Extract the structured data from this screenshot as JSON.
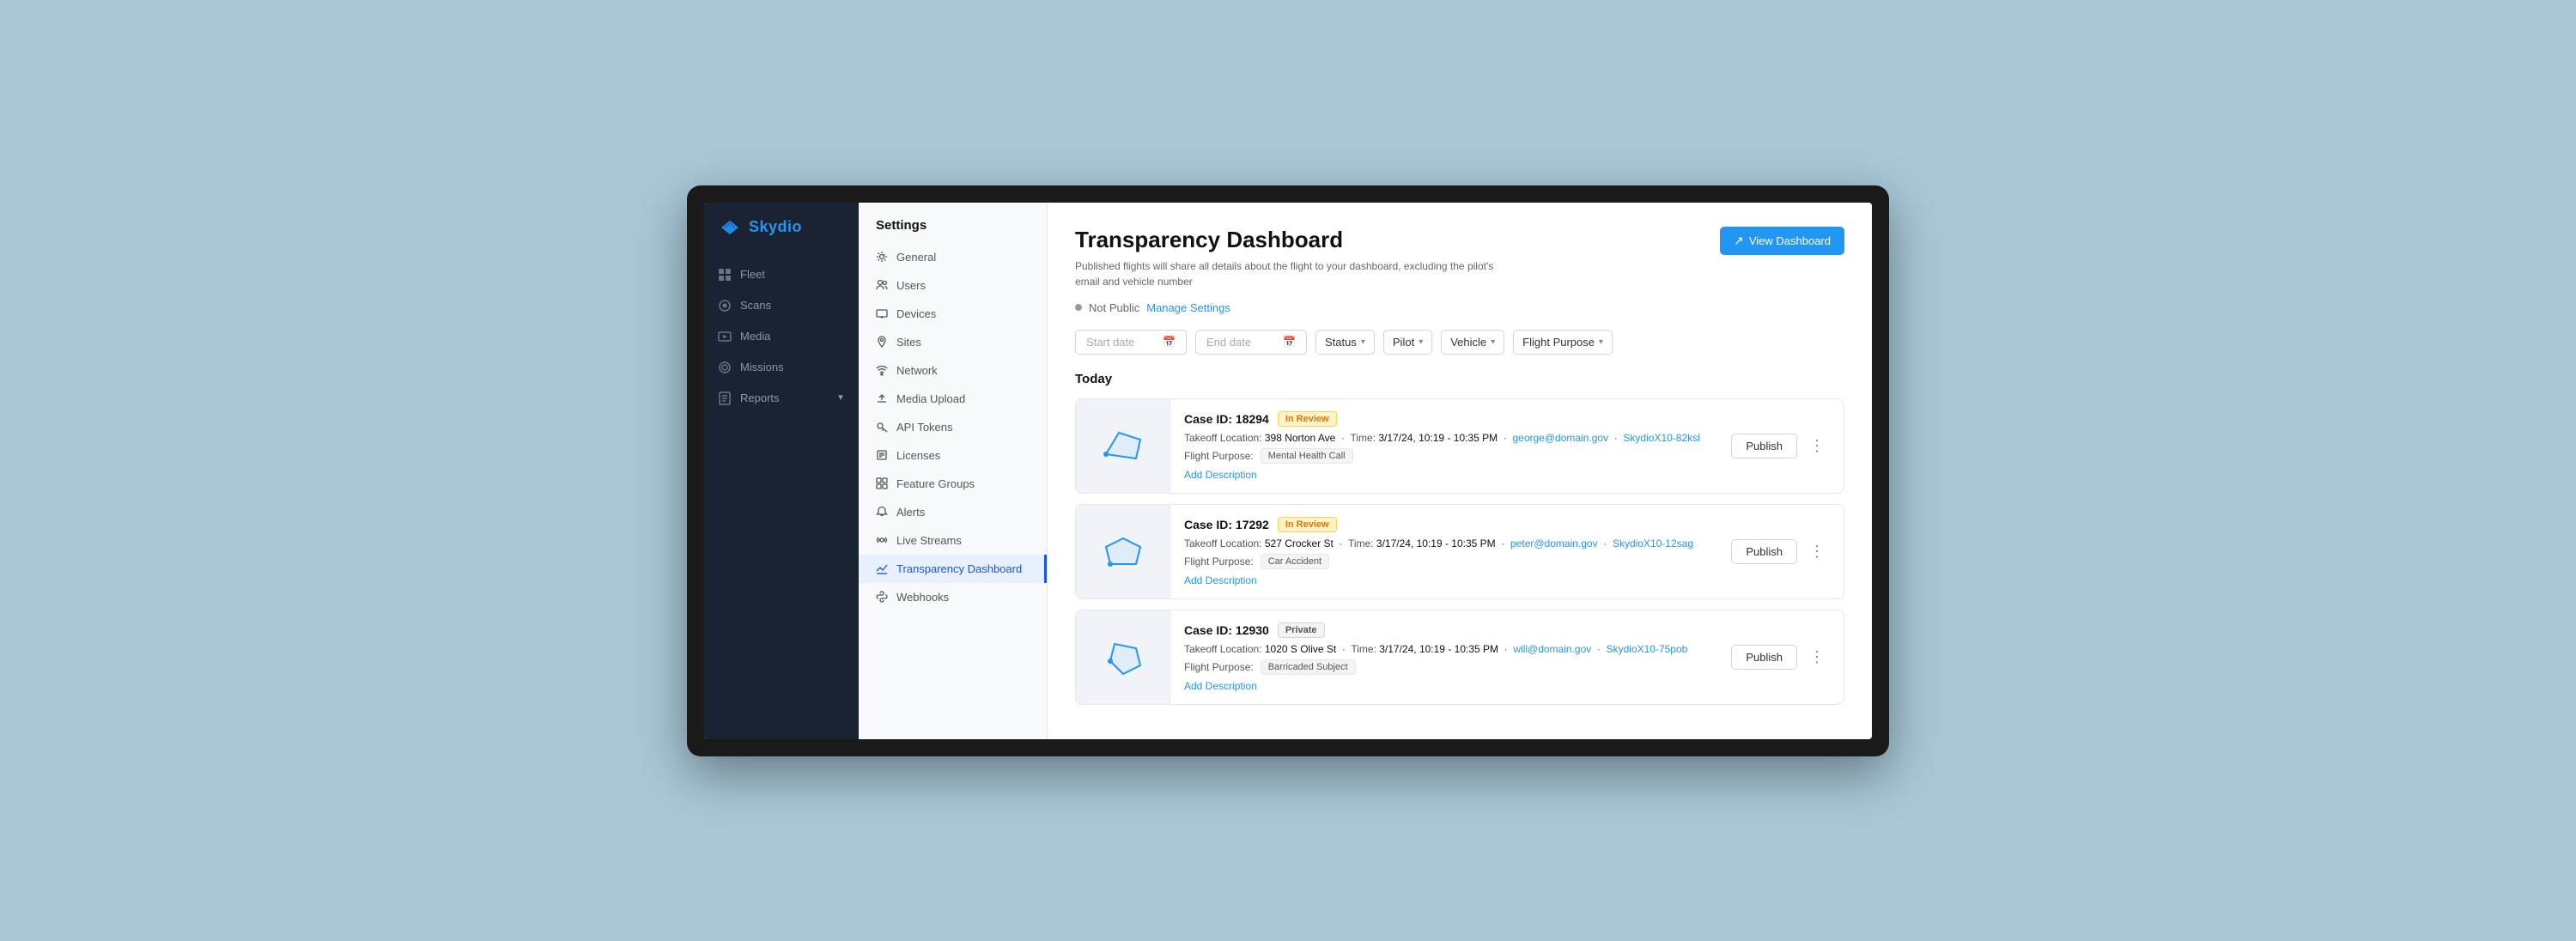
{
  "app": {
    "name": "Skydio"
  },
  "left_nav": {
    "items": [
      {
        "id": "fleet",
        "label": "Fleet",
        "icon": "grid"
      },
      {
        "id": "scans",
        "label": "Scans",
        "icon": "scan"
      },
      {
        "id": "media",
        "label": "Media",
        "icon": "media"
      },
      {
        "id": "missions",
        "label": "Missions",
        "icon": "target"
      },
      {
        "id": "reports",
        "label": "Reports",
        "icon": "reports",
        "hasExpand": true
      }
    ]
  },
  "settings_sidebar": {
    "title": "Settings",
    "items": [
      {
        "id": "general",
        "label": "General",
        "icon": "gear"
      },
      {
        "id": "users",
        "label": "Users",
        "icon": "users"
      },
      {
        "id": "devices",
        "label": "Devices",
        "icon": "devices"
      },
      {
        "id": "sites",
        "label": "Sites",
        "icon": "location"
      },
      {
        "id": "network",
        "label": "Network",
        "icon": "wifi"
      },
      {
        "id": "media-upload",
        "label": "Media Upload",
        "icon": "upload"
      },
      {
        "id": "api-tokens",
        "label": "API Tokens",
        "icon": "key"
      },
      {
        "id": "licenses",
        "label": "Licenses",
        "icon": "license"
      },
      {
        "id": "feature-groups",
        "label": "Feature Groups",
        "icon": "feature"
      },
      {
        "id": "alerts",
        "label": "Alerts",
        "icon": "bell"
      },
      {
        "id": "live-streams",
        "label": "Live Streams",
        "icon": "stream"
      },
      {
        "id": "transparency-dashboard",
        "label": "Transparency Dashboard",
        "icon": "dashboard",
        "active": true
      },
      {
        "id": "webhooks",
        "label": "Webhooks",
        "icon": "webhook"
      }
    ]
  },
  "page": {
    "title": "Transparency Dashboard",
    "subtitle": "Published flights will share all details about the flight to your dashboard, excluding the pilot's email and vehicle number",
    "view_dashboard_btn": "View Dashboard",
    "status_label": "Not Public",
    "manage_link": "Manage Settings",
    "today_label": "Today"
  },
  "filters": {
    "start_date_placeholder": "Start date",
    "end_date_placeholder": "End date",
    "status_label": "Status",
    "pilot_label": "Pilot",
    "vehicle_label": "Vehicle",
    "flight_purpose_label": "Flight Purpose"
  },
  "flights": [
    {
      "case_id": "Case ID: 18294",
      "status": "In Review",
      "status_type": "review",
      "takeoff_location": "398 Norton Ave",
      "time": "3/17/24, 10:19 - 10:35 PM",
      "pilot_email": "george@domain.gov",
      "vehicle": "SkydioX10-82ksl",
      "flight_purpose_label": "Flight Purpose:",
      "flight_purpose": "Mental Health Call",
      "add_description": "Add Description",
      "publish_btn": "Publish",
      "map_type": "pentagon"
    },
    {
      "case_id": "Case ID: 17292",
      "status": "In Review",
      "status_type": "review",
      "takeoff_location": "527 Crocker St",
      "time": "3/17/24, 10:19 - 10:35 PM",
      "pilot_email": "peter@domain.gov",
      "vehicle": "SkydioX10-12sag",
      "flight_purpose_label": "Flight Purpose:",
      "flight_purpose": "Car Accident",
      "add_description": "Add Description",
      "publish_btn": "Publish",
      "map_type": "polygon"
    },
    {
      "case_id": "Case ID: 12930",
      "status": "Private",
      "status_type": "private",
      "takeoff_location": "1020 S Olive St",
      "time": "3/17/24, 10:19 - 10:35 PM",
      "pilot_email": "will@domain.gov",
      "vehicle": "SkydioX10-75pob",
      "flight_purpose_label": "Flight Purpose:",
      "flight_purpose": "Barricaded Subject",
      "add_description": "Add Description",
      "publish_btn": "Publish",
      "map_type": "irregular"
    }
  ]
}
